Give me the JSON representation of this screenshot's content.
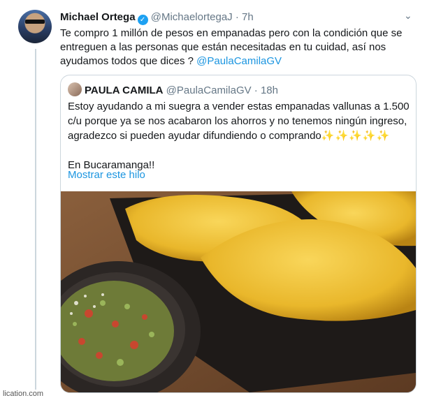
{
  "tweet": {
    "name": "Michael Ortega",
    "handle": "@MichaelortegaJ",
    "dot": "·",
    "time": "7h",
    "text_main": "Te compro 1 millón de pesos en empanadas pero con la condición que se entreguen a las personas que están necesitadas en tu cuidad, así nos ayudamos todos que dices ? ",
    "mention": "@PaulaCamilaGV",
    "verified_icon": "✓",
    "chevron_icon": "⌄"
  },
  "quote": {
    "name": "PAULA CAMILA",
    "handle": "@PaulaCamilaGV",
    "dot": "·",
    "time": "18h",
    "text_main": "Estoy ayudando a mi suegra a vender estas empanadas vallunas a 1.500 c/u porque ya se nos acabaron los ahorros y no tenemos ningún ingreso, agradezco si pueden ayudar difundiendo o comprando",
    "sparkles": "✨✨✨✨✨",
    "text_city": "En Bucaramanga!!",
    "show_thread": "Mostrar este hilo"
  },
  "footer": {
    "partial_text": "lication.com"
  },
  "colors": {
    "link": "#1b95e0",
    "verified": "#1da1f2",
    "muted": "#657786"
  }
}
